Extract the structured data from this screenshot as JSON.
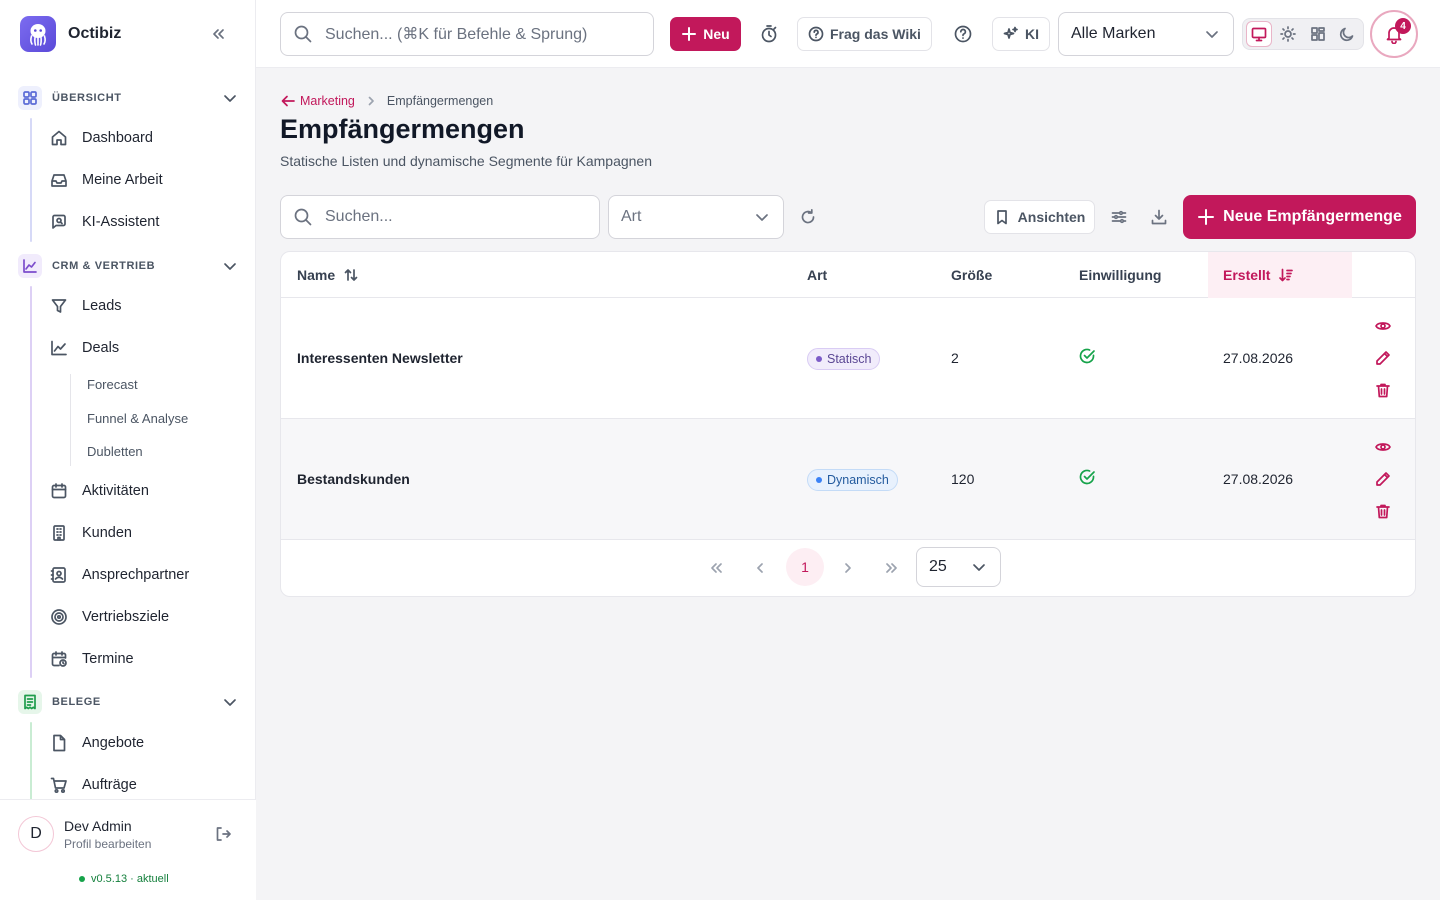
{
  "app": {
    "name": "Octibiz",
    "accent_color": "#c2185b"
  },
  "sidebar": {
    "sections": [
      {
        "title": "ÜBERSICHT",
        "items": [
          "Dashboard",
          "Meine Arbeit",
          "KI-Assistent"
        ]
      },
      {
        "title": "CRM & VERTRIEB",
        "items": [
          "Leads",
          "Deals",
          "Aktivitäten",
          "Kunden",
          "Ansprechpartner",
          "Vertriebsziele",
          "Termine"
        ],
        "deal_subitems": [
          "Forecast",
          "Funnel & Analyse",
          "Dubletten"
        ]
      },
      {
        "title": "BELEGE",
        "items": [
          "Angebote",
          "Aufträge"
        ]
      }
    ],
    "user": {
      "initial": "D",
      "name": "Dev Admin",
      "sub": "Profil bearbeiten"
    },
    "version": "v0.5.13 · aktuell"
  },
  "topbar": {
    "search_placeholder": "Suchen... (⌘K für Befehle & Sprung)",
    "new_label": "Neu",
    "wiki_label": "Frag das Wiki",
    "ai_label": "KI",
    "brand_select": "Alle Marken",
    "notification_count": "4"
  },
  "page": {
    "breadcrumb_parent": "Marketing",
    "breadcrumb_current": "Empfängermengen",
    "title": "Empfängermengen",
    "subtitle": "Statische Listen und dynamische Segmente für Kampagnen"
  },
  "toolbar": {
    "search_placeholder": "Suchen...",
    "type_filter": "Art",
    "views_label": "Ansichten",
    "primary_label": "Neue Empfängermenge"
  },
  "table": {
    "columns": {
      "name": "Name",
      "type": "Art",
      "size": "Größe",
      "consent": "Einwilligung",
      "created": "Erstellt"
    },
    "rows": [
      {
        "name": "Interessenten Newsletter",
        "type": "Statisch",
        "size": "2",
        "consent": true,
        "created": "27.08.2026"
      },
      {
        "name": "Bestandskunden",
        "type": "Dynamisch",
        "size": "120",
        "consent": true,
        "created": "27.08.2026"
      }
    ]
  },
  "pagination": {
    "current_page": "1",
    "page_size": "25"
  }
}
